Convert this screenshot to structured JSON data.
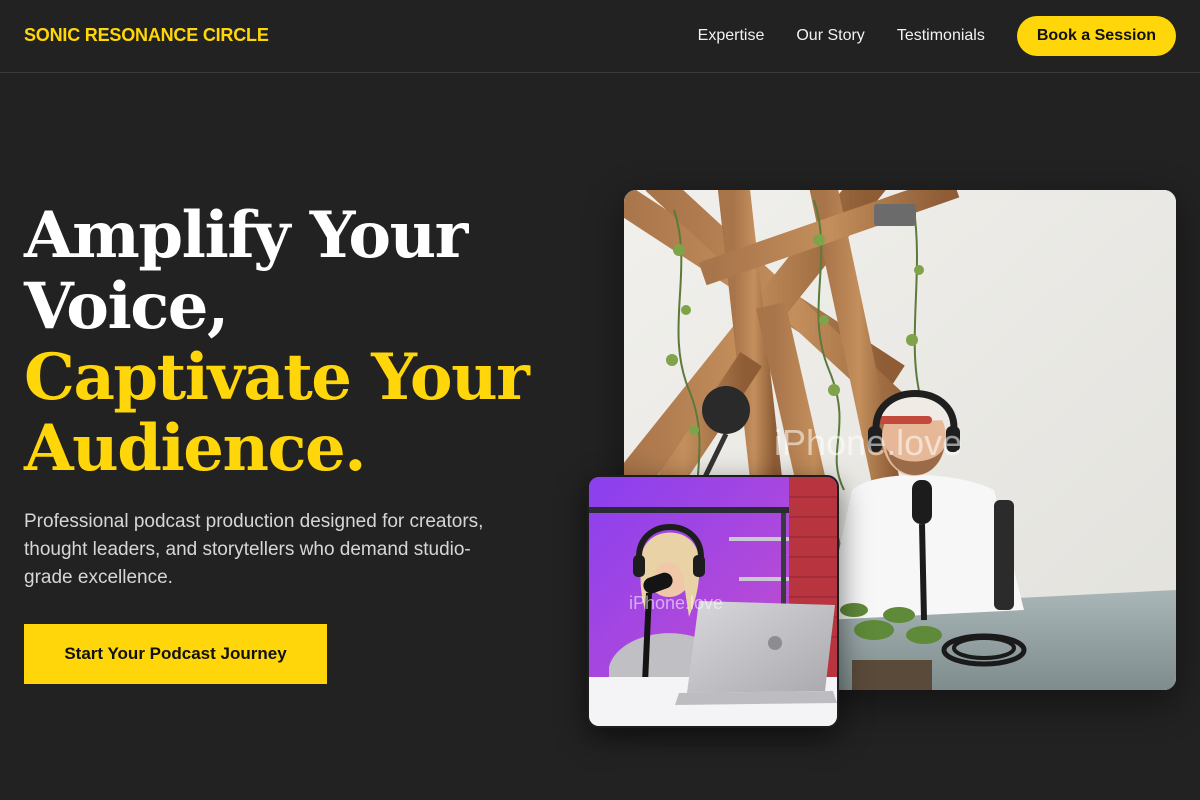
{
  "brand": {
    "name": "SONIC RESONANCE CIRCLE",
    "accent_color": "#FFD60A",
    "background_color": "#222222"
  },
  "nav": {
    "links": [
      "Expertise",
      "Our Story",
      "Testimonials"
    ],
    "cta_label": "Book a Session"
  },
  "hero": {
    "title_lines": [
      "Amplify Your",
      "Voice,"
    ],
    "title_accent_lines": [
      "Captivate Your",
      "Audience."
    ],
    "subtitle": "Professional podcast production designed for creators, thought leaders, and storytellers who demand studio-grade excellence.",
    "cta_label": "Start Your Podcast Journey"
  },
  "images": {
    "main": {
      "description_icon": "podcast-studio-photo",
      "watermark": "iPhone.love"
    },
    "secondary": {
      "description_icon": "podcaster-laptop-photo",
      "watermark": "iPhone.love"
    }
  }
}
